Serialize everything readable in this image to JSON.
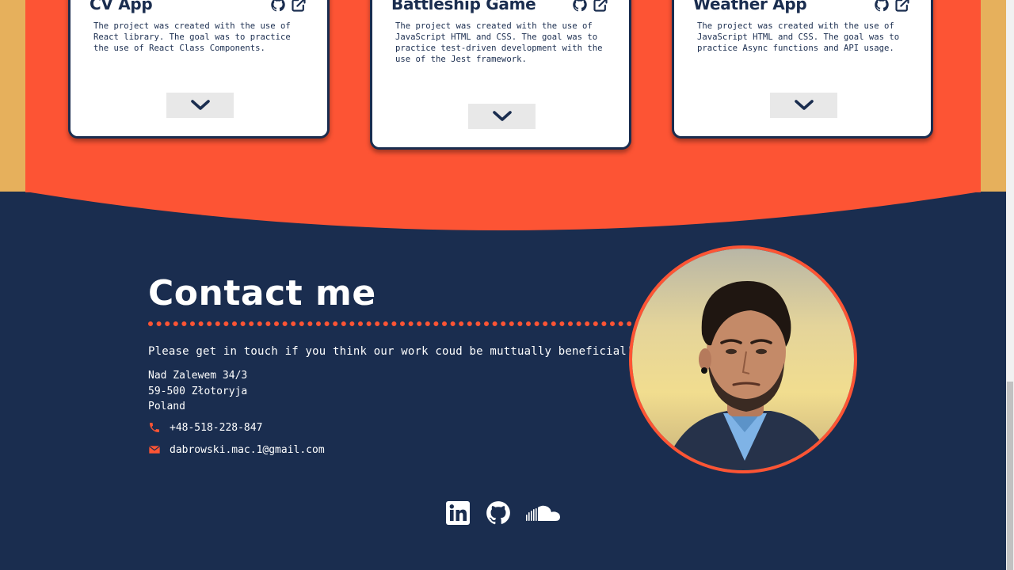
{
  "projects": [
    {
      "title": "CV App",
      "description": "The project was created with the use of\nReact library. The goal was to practice\nthe use of React Class Components."
    },
    {
      "title": "Battleship Game",
      "description": "The project was created with the use of\nJavaScript HTML and CSS. The goal was to\npractice test-driven development with the\nuse of the Jest framework."
    },
    {
      "title": "Weather App",
      "description": "The project was created with the use of\nJavaScript HTML and CSS. The goal was to\npractice Async functions and API usage."
    }
  ],
  "contact": {
    "title": "Contact me",
    "tagline": "Please get in touch if you think our work coud be muttually beneficial!",
    "address": [
      "Nad Zalewem 34/3",
      "59-500 Złotoryja",
      "Poland"
    ],
    "phone": "+48-518-228-847",
    "email": "dabrowski.mac.1@gmail.com"
  },
  "icons": {
    "card_icons": [
      "github-icon",
      "external-link-icon"
    ],
    "toggle": "chevron-down-icon",
    "contact": [
      "phone-icon",
      "envelope-icon"
    ],
    "socials": [
      "linkedin-icon",
      "github-icon",
      "soundcloud-icon"
    ]
  },
  "colors": {
    "navy": "#1a2d4f",
    "orange": "#fd5434",
    "gold": "#e6b05c",
    "white": "#ffffff",
    "button_grey": "#e8e8e8"
  }
}
